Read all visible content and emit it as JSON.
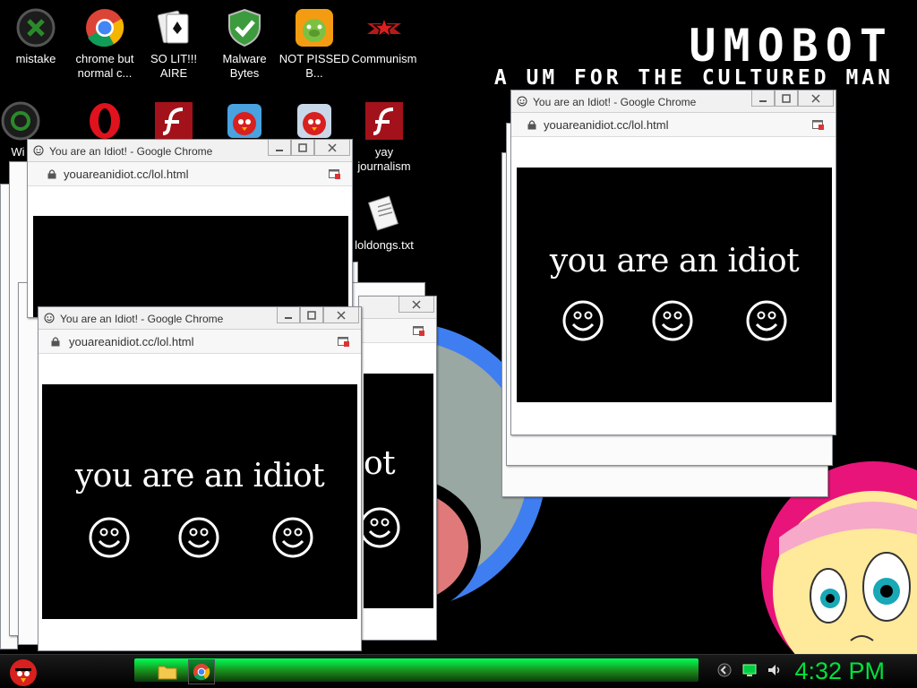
{
  "wallpaper": {
    "title": "UMOBOT",
    "subtitle": "A UM FOR THE CULTURED MAN"
  },
  "desktop_icons": [
    {
      "label": "mistake",
      "icon": "recycle-bin-full-icon"
    },
    {
      "label": "chrome but normal c...",
      "icon": "chrome-icon"
    },
    {
      "label": "SO LIT!!! AIRE",
      "icon": "solitaire-icon"
    },
    {
      "label": "Malware Bytes",
      "icon": "shield-check-icon"
    },
    {
      "label": "NOT PISSED B...",
      "icon": "green-pig-icon"
    },
    {
      "label": "Communism",
      "icon": "red-star-flag-icon"
    },
    {
      "label": "Wi",
      "icon": "recycle-bin-icon"
    },
    {
      "label": "",
      "icon": "opera-icon"
    },
    {
      "label": "",
      "icon": "flash-icon"
    },
    {
      "label": "",
      "icon": "angry-bird-icon"
    },
    {
      "label": "",
      "icon": "angry-bird-icon"
    },
    {
      "label": "yay journalism",
      "icon": "flash-icon"
    },
    {
      "label": "loldongs.txt",
      "icon": "text-file-icon"
    }
  ],
  "popup": {
    "window_title": "You are an Idiot! - Google Chrome",
    "url": "youareanidiot.cc/lol.html",
    "message": "you are an idiot",
    "message_fragment": "ot"
  },
  "taskbar": {
    "clock": "4:32 PM",
    "items": [
      "start-orb-angry-bird",
      "file-explorer",
      "google-chrome"
    ]
  },
  "colors": {
    "clock_green": "#00e13c",
    "taskbar_green": "#1a8a1a",
    "ring_blue": "#3f7ef0",
    "ring_pink": "#e8147a"
  }
}
